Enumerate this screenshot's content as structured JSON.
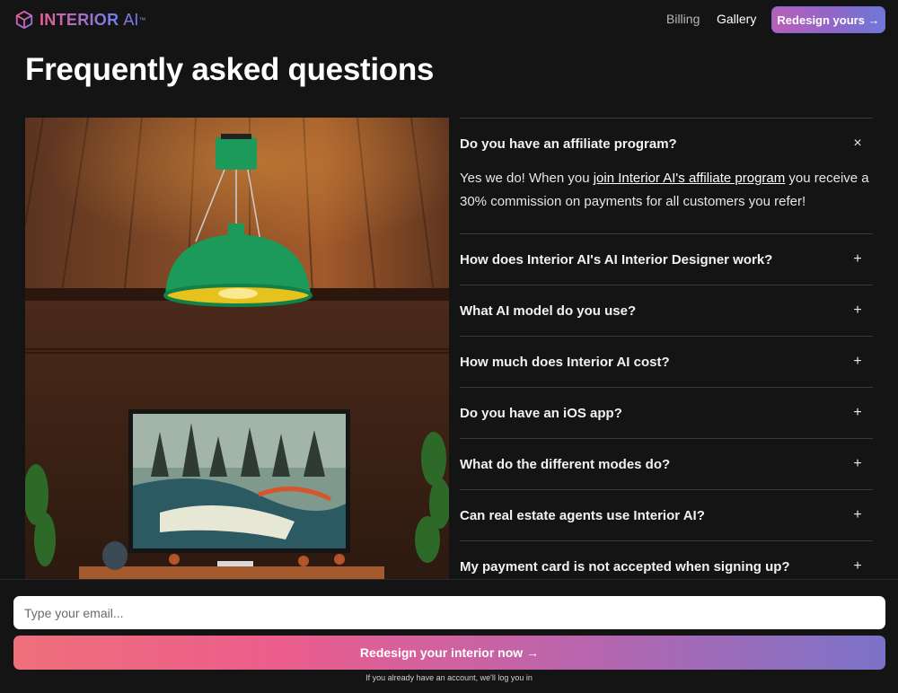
{
  "header": {
    "logo_main": "INTERIOR",
    "logo_sub": "AI",
    "logo_tm": "™",
    "nav": {
      "billing": "Billing",
      "gallery": "Gallery"
    },
    "cta": "Redesign yours →"
  },
  "page_title": "Frequently asked questions",
  "faq": {
    "open": {
      "question": "Do you have an affiliate program?",
      "toggle": "×",
      "answer_before": "Yes we do! When you ",
      "answer_link": "join Interior AI's affiliate program",
      "answer_after": " you receive a 30% commission on payments for all customers you refer!"
    },
    "items": [
      {
        "question": "How does Interior AI's AI Interior Designer work?",
        "toggle": "+"
      },
      {
        "question": "What AI model do you use?",
        "toggle": "+"
      },
      {
        "question": "How much does Interior AI cost?",
        "toggle": "+"
      },
      {
        "question": "Do you have an iOS app?",
        "toggle": "+"
      },
      {
        "question": "What do the different modes do?",
        "toggle": "+"
      },
      {
        "question": "Can real estate agents use Interior AI?",
        "toggle": "+"
      },
      {
        "question": "My payment card is not accepted when signing up?",
        "toggle": "+"
      }
    ]
  },
  "signup": {
    "email_placeholder": "Type your email...",
    "cta": "Redesign your interior now →",
    "note": "If you already have an account, we'll log you in"
  },
  "colors": {
    "background": "#141414",
    "brand_pink": "#ec5f94",
    "brand_purple": "#a470c9",
    "brand_blue": "#6f7ff0"
  }
}
